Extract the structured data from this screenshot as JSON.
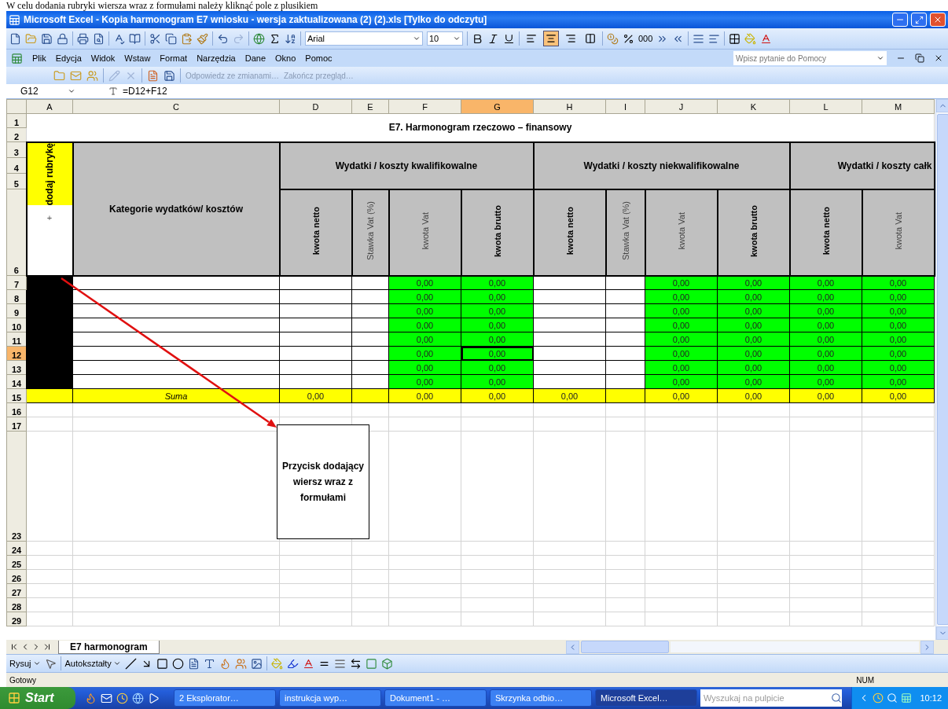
{
  "document_caption": "W celu dodania rubryki wiersza wraz z formułami należy kliknąć pole z plusikiem",
  "window": {
    "title": "Microsoft Excel - Kopia harmonogram E7 wniosku - wersja zaktualizowana (2) (2).xls  [Tylko do odczytu]"
  },
  "formatting_toolbar": {
    "font": "Arial",
    "size": "10",
    "alignments": [
      {
        "kind": "left",
        "selected": false
      },
      {
        "kind": "center",
        "selected": true
      },
      {
        "kind": "right",
        "selected": false
      },
      {
        "kind": "merge",
        "selected": false
      }
    ],
    "thousands_label": "000"
  },
  "menu": [
    "Plik",
    "Edycja",
    "Widok",
    "Wstaw",
    "Format",
    "Narzędzia",
    "Dane",
    "Okno",
    "Pomoc"
  ],
  "help_placeholder": "Wpisz pytanie do Pomocy",
  "review_toolbar": [
    "Odpowiedz ze zmianami…",
    "Zakończ przegląd…"
  ],
  "name_box": "G12",
  "formula": "=D12+F12",
  "columns": [
    {
      "label": "A",
      "selected": false
    },
    {
      "label": "C",
      "selected": false
    },
    {
      "label": "D",
      "selected": false
    },
    {
      "label": "E",
      "selected": false
    },
    {
      "label": "F",
      "selected": false
    },
    {
      "label": "G",
      "selected": true
    },
    {
      "label": "H",
      "selected": false
    },
    {
      "label": "I",
      "selected": false
    },
    {
      "label": "J",
      "selected": false
    },
    {
      "label": "K",
      "selected": false
    },
    {
      "label": "L",
      "selected": false
    },
    {
      "label": "M",
      "selected": false
    }
  ],
  "sheet": {
    "header_row_labels": [
      "1",
      "2",
      "3",
      "4",
      "5",
      "6"
    ],
    "title": "E7. Harmonogram rzeczowo – finansowy",
    "add_label": "dodaj rubrykę",
    "add_button": "+",
    "category_header": "Kategorie wydatków/ kosztów",
    "groups": [
      {
        "label": "Wydatki / koszty kwalifikowalne",
        "subcolumns": [
          {
            "label": "kwota netto",
            "kind": "input",
            "bold": true
          },
          {
            "label": "Stawka Vat (%)",
            "kind": "rate",
            "bold": false
          },
          {
            "label": "kwota Vat",
            "kind": "formula",
            "bold": false
          },
          {
            "label": "kwota brutto",
            "kind": "formula",
            "bold": true
          }
        ]
      },
      {
        "label": "Wydatki / koszty niekwalifikowalne",
        "subcolumns": [
          {
            "label": "kwota netto",
            "kind": "input",
            "bold": true
          },
          {
            "label": "Stawka Vat (%)",
            "kind": "rate",
            "bold": false
          },
          {
            "label": "kwota Vat",
            "kind": "formula",
            "bold": false
          },
          {
            "label": "kwota brutto",
            "kind": "formula",
            "bold": true
          }
        ]
      },
      {
        "label": "Wydatki / koszty całk",
        "subcolumns": [
          {
            "label": "kwota netto",
            "kind": "formula",
            "bold": true
          },
          {
            "label": "kwota Vat",
            "kind": "formula",
            "bold": false
          }
        ]
      }
    ],
    "rows": [
      {
        "label": "7",
        "selected": false,
        "values": [
          "0,00",
          "0,00",
          "0,00",
          "0,00",
          "0,00",
          "0,00"
        ]
      },
      {
        "label": "8",
        "selected": false,
        "values": [
          "0,00",
          "0,00",
          "0,00",
          "0,00",
          "0,00",
          "0,00"
        ]
      },
      {
        "label": "9",
        "selected": false,
        "values": [
          "0,00",
          "0,00",
          "0,00",
          "0,00",
          "0,00",
          "0,00"
        ]
      },
      {
        "label": "10",
        "selected": false,
        "values": [
          "0,00",
          "0,00",
          "0,00",
          "0,00",
          "0,00",
          "0,00"
        ]
      },
      {
        "label": "11",
        "selected": false,
        "values": [
          "0,00",
          "0,00",
          "0,00",
          "0,00",
          "0,00",
          "0,00"
        ]
      },
      {
        "label": "12",
        "selected": true,
        "values": [
          "0,00",
          "0,00",
          "0,00",
          "0,00",
          "0,00",
          "0,00"
        ]
      },
      {
        "label": "13",
        "selected": false,
        "values": [
          "0,00",
          "0,00",
          "0,00",
          "0,00",
          "0,00",
          "0,00"
        ]
      },
      {
        "label": "14",
        "selected": false,
        "values": [
          "0,00",
          "0,00",
          "0,00",
          "0,00",
          "0,00",
          "0,00"
        ]
      }
    ],
    "sum_row": {
      "label": "15",
      "text": "Suma",
      "values": [
        "0,00",
        "0,00",
        "0,00",
        "0,00",
        "0,00",
        "0,00",
        "0,00",
        "0,00"
      ]
    },
    "empty_rows": [
      {
        "label": "16",
        "kind": "normal"
      },
      {
        "label": "17",
        "kind": "normal"
      },
      {
        "label": "23",
        "kind": "tall"
      },
      {
        "label": "24",
        "kind": "normal"
      },
      {
        "label": "25",
        "kind": "normal"
      },
      {
        "label": "26",
        "kind": "normal"
      },
      {
        "label": "27",
        "kind": "normal"
      },
      {
        "label": "28",
        "kind": "normal"
      },
      {
        "label": "29",
        "kind": "normal"
      }
    ],
    "callout": "Przycisk dodający wiersz wraz z formułami"
  },
  "sheet_tabs": [
    {
      "label": "E7 harmonogram",
      "selected": true
    }
  ],
  "drawing_toolbar": [
    "Rysuj",
    "Autokształty"
  ],
  "status_bar": {
    "text": "Gotowy",
    "indicator": "NUM"
  },
  "taskbar": {
    "start": "Start",
    "tasks": [
      {
        "label": "2 Eksplorator…",
        "selected": false
      },
      {
        "label": "instrukcja wyp…",
        "selected": false
      },
      {
        "label": "Dokument1 - …",
        "selected": false
      },
      {
        "label": "Skrzynka odbio…",
        "selected": false
      },
      {
        "label": "Microsoft Excel…",
        "selected": true
      }
    ],
    "search_placeholder": "Wyszukaj na pulpicie",
    "clock": "10:12"
  }
}
